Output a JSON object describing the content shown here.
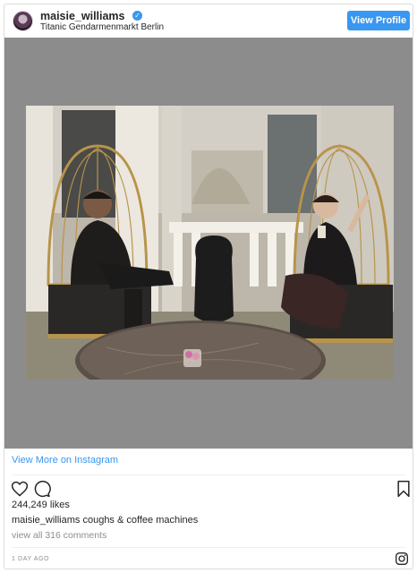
{
  "header": {
    "username": "maisie_williams",
    "verified_icon": "verified-badge-icon",
    "location": "Titanic Gendarmenmarkt Berlin",
    "view_profile_label": "View Profile"
  },
  "media": {
    "alt": "",
    "frame_color": "#8c8c8c"
  },
  "view_more_label": "View More on Instagram",
  "actions": {
    "like_icon": "heart-icon",
    "comment_icon": "comment-icon",
    "save_icon": "bookmark-icon"
  },
  "likes": "244,249 likes",
  "caption": {
    "username": "maisie_williams",
    "text": " coughs & coffee machines"
  },
  "comments_link": "view all 316 comments",
  "timestamp": "1 DAY AGO",
  "colors": {
    "accent": "#3897f0",
    "text": "#262626",
    "muted": "#8e8e8e"
  }
}
